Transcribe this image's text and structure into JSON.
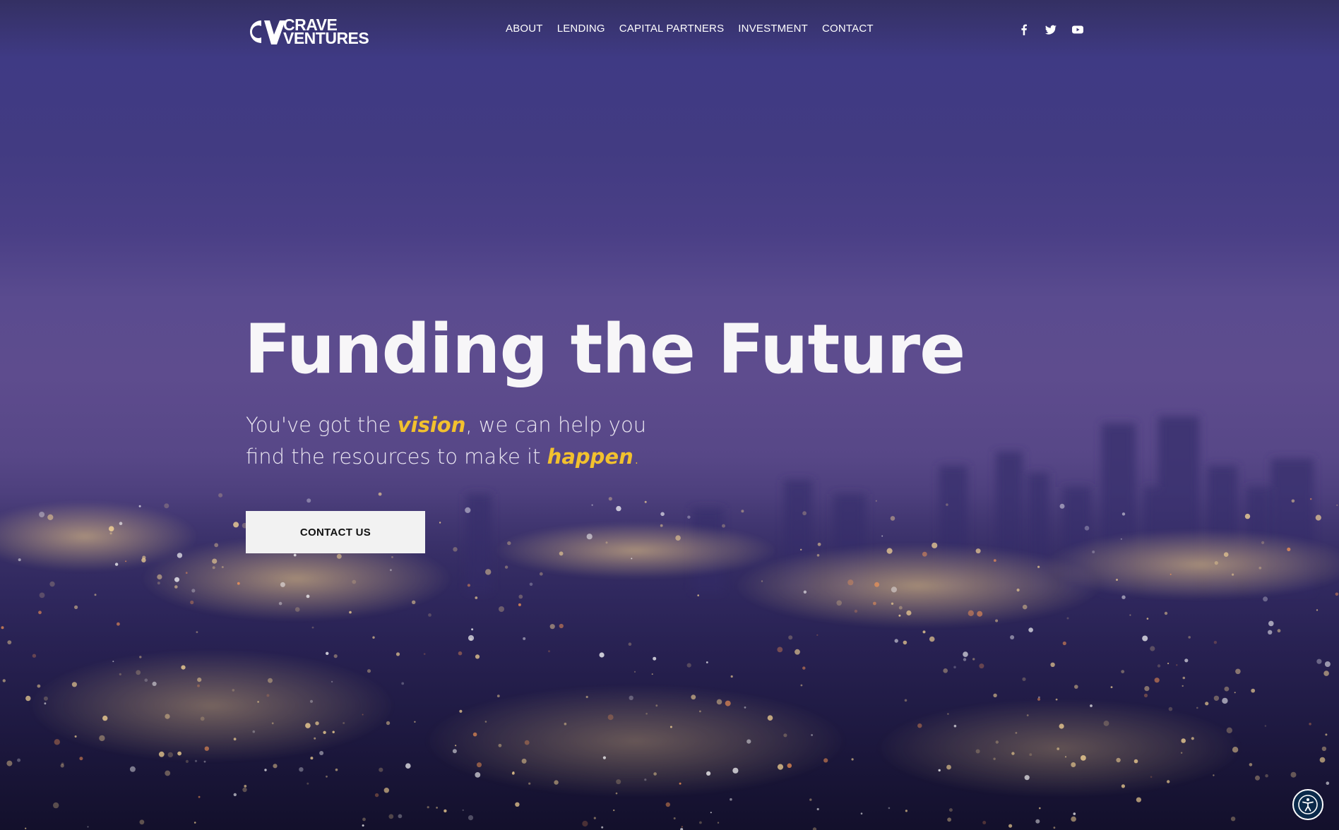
{
  "brand": {
    "line1": "CRAVE",
    "line2": "VENTURES",
    "logo_icon": "crave-ventures-logo-icon"
  },
  "nav": {
    "items": [
      {
        "label": "ABOUT"
      },
      {
        "label": "LENDING"
      },
      {
        "label": "CAPITAL PARTNERS"
      },
      {
        "label": "INVESTMENT"
      },
      {
        "label": "CONTACT"
      }
    ]
  },
  "social": {
    "icons": [
      "facebook-icon",
      "twitter-icon",
      "youtube-icon"
    ]
  },
  "hero": {
    "headline": "Funding the Future",
    "subhead": {
      "part1": "You've got the ",
      "emphasis1": "vision",
      "part2": ", we can help you find the resources to make it ",
      "emphasis2": "happen",
      "period": "."
    },
    "cta_label": "CONTACT US"
  },
  "accessibility": {
    "icon": "accessibility-icon"
  },
  "colors": {
    "accent": "#f2c12e",
    "button_bg": "#f2f2f2",
    "sky_top": "#343063",
    "city_bottom": "#181535"
  }
}
